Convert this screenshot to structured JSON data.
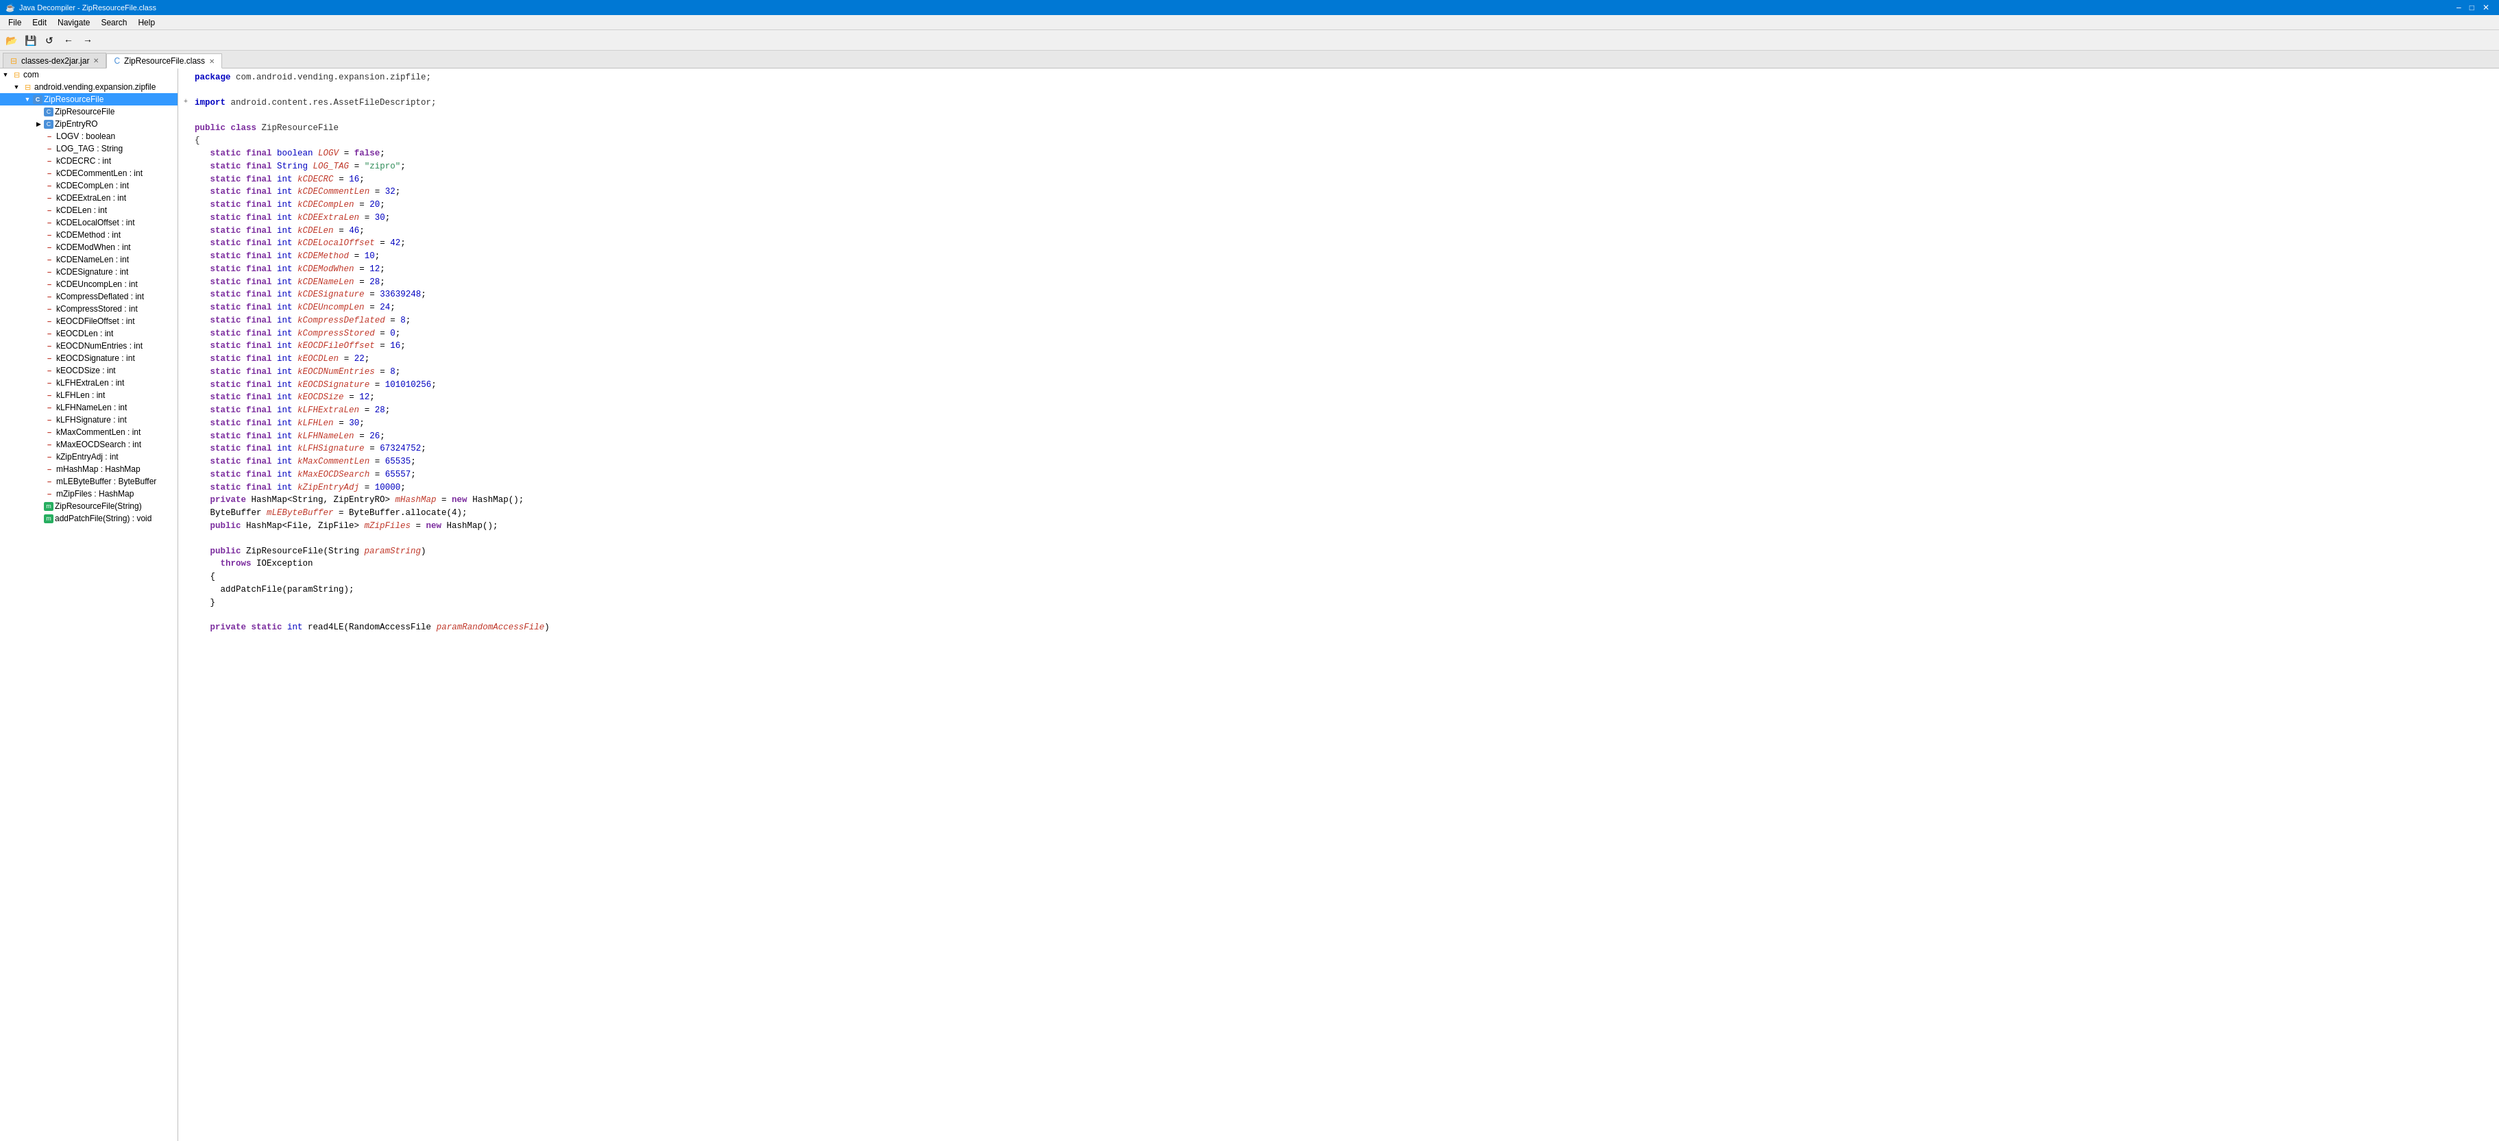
{
  "titleBar": {
    "title": "Java Decompiler - ZipResourceFile.class",
    "controls": [
      "–",
      "□",
      "✕"
    ]
  },
  "menuBar": {
    "items": [
      "File",
      "Edit",
      "Navigate",
      "Search",
      "Help"
    ]
  },
  "toolbar": {
    "buttons": [
      "📂",
      "💾",
      "↩",
      "←",
      "→"
    ]
  },
  "tabs": {
    "openTabs": [
      {
        "label": "classes-dex2jar.jar",
        "closeable": true,
        "active": false
      },
      {
        "label": "ZipResourceFile.class",
        "closeable": true,
        "active": true
      }
    ]
  },
  "tree": {
    "items": [
      {
        "indent": 0,
        "expand": "▼",
        "icon": "□",
        "iconClass": "icon-package",
        "label": "com",
        "type": "package"
      },
      {
        "indent": 1,
        "expand": "▼",
        "icon": "□",
        "iconClass": "icon-package",
        "label": "android.vending.expansion.zipfile",
        "type": "package"
      },
      {
        "indent": 2,
        "expand": "▼",
        "icon": "C",
        "iconClass": "icon-class",
        "label": "ZipResourceFile",
        "type": "class",
        "selected": true
      },
      {
        "indent": 3,
        "expand": " ",
        "icon": "C",
        "iconClass": "icon-class",
        "label": "ZipResourceFile",
        "type": "class"
      },
      {
        "indent": 3,
        "expand": "▶",
        "icon": "C",
        "iconClass": "icon-class",
        "label": "ZipEntryRO",
        "type": "class"
      },
      {
        "indent": 3,
        "expand": " ",
        "icon": "f",
        "iconClass": "icon-field",
        "label": "LOGV : boolean",
        "type": "field"
      },
      {
        "indent": 3,
        "expand": " ",
        "icon": "f",
        "iconClass": "icon-field",
        "label": "LOG_TAG : String",
        "type": "field"
      },
      {
        "indent": 3,
        "expand": " ",
        "icon": "f",
        "iconClass": "icon-field",
        "label": "kCDECRC : int",
        "type": "field"
      },
      {
        "indent": 3,
        "expand": " ",
        "icon": "f",
        "iconClass": "icon-field",
        "label": "kCDECommentLen : int",
        "type": "field"
      },
      {
        "indent": 3,
        "expand": " ",
        "icon": "f",
        "iconClass": "icon-field",
        "label": "kCDECompLen : int",
        "type": "field"
      },
      {
        "indent": 3,
        "expand": " ",
        "icon": "f",
        "iconClass": "icon-field",
        "label": "kCDEExtraLen : int",
        "type": "field"
      },
      {
        "indent": 3,
        "expand": " ",
        "icon": "f",
        "iconClass": "icon-field",
        "label": "kCDELen : int",
        "type": "field"
      },
      {
        "indent": 3,
        "expand": " ",
        "icon": "f",
        "iconClass": "icon-field",
        "label": "kCDELocalOffset : int",
        "type": "field"
      },
      {
        "indent": 3,
        "expand": " ",
        "icon": "f",
        "iconClass": "icon-field",
        "label": "kCDEMethod : int",
        "type": "field"
      },
      {
        "indent": 3,
        "expand": " ",
        "icon": "f",
        "iconClass": "icon-field",
        "label": "kCDEModWhen : int",
        "type": "field"
      },
      {
        "indent": 3,
        "expand": " ",
        "icon": "f",
        "iconClass": "icon-field",
        "label": "kCDENameLen : int",
        "type": "field"
      },
      {
        "indent": 3,
        "expand": " ",
        "icon": "f",
        "iconClass": "icon-field",
        "label": "kCDESignature : int",
        "type": "field"
      },
      {
        "indent": 3,
        "expand": " ",
        "icon": "f",
        "iconClass": "icon-field",
        "label": "kCDEUncompLen : int",
        "type": "field"
      },
      {
        "indent": 3,
        "expand": " ",
        "icon": "f",
        "iconClass": "icon-field",
        "label": "kCompressDeflated : int",
        "type": "field"
      },
      {
        "indent": 3,
        "expand": " ",
        "icon": "f",
        "iconClass": "icon-field",
        "label": "kCompressStored : int",
        "type": "field"
      },
      {
        "indent": 3,
        "expand": " ",
        "icon": "f",
        "iconClass": "icon-field",
        "label": "kEOCDFileOffset : int",
        "type": "field"
      },
      {
        "indent": 3,
        "expand": " ",
        "icon": "f",
        "iconClass": "icon-field",
        "label": "kEOCDLen : int",
        "type": "field"
      },
      {
        "indent": 3,
        "expand": " ",
        "icon": "f",
        "iconClass": "icon-field",
        "label": "kEOCDNumEntries : int",
        "type": "field"
      },
      {
        "indent": 3,
        "expand": " ",
        "icon": "f",
        "iconClass": "icon-field",
        "label": "kEOCDSignature : int",
        "type": "field"
      },
      {
        "indent": 3,
        "expand": " ",
        "icon": "f",
        "iconClass": "icon-field",
        "label": "kEOCDSize : int",
        "type": "field"
      },
      {
        "indent": 3,
        "expand": " ",
        "icon": "f",
        "iconClass": "icon-field",
        "label": "kLFHExtraLen : int",
        "type": "field"
      },
      {
        "indent": 3,
        "expand": " ",
        "icon": "f",
        "iconClass": "icon-field",
        "label": "kLFHLen : int",
        "type": "field"
      },
      {
        "indent": 3,
        "expand": " ",
        "icon": "f",
        "iconClass": "icon-field",
        "label": "kLFHNameLen : int",
        "type": "field"
      },
      {
        "indent": 3,
        "expand": " ",
        "icon": "f",
        "iconClass": "icon-field",
        "label": "kLFHSignature : int",
        "type": "field"
      },
      {
        "indent": 3,
        "expand": " ",
        "icon": "f",
        "iconClass": "icon-field",
        "label": "kMaxCommentLen : int",
        "type": "field"
      },
      {
        "indent": 3,
        "expand": " ",
        "icon": "f",
        "iconClass": "icon-field",
        "label": "kMaxEOCDSearch : int",
        "type": "field"
      },
      {
        "indent": 3,
        "expand": " ",
        "icon": "f",
        "iconClass": "icon-field",
        "label": "kZipEntryAdj : int",
        "type": "field"
      },
      {
        "indent": 3,
        "expand": " ",
        "icon": "f",
        "iconClass": "icon-field",
        "label": "mHashMap : HashMap<Str...",
        "type": "field"
      },
      {
        "indent": 3,
        "expand": " ",
        "icon": "f",
        "iconClass": "icon-field",
        "label": "mLEByteBuffer : ByteBuffer",
        "type": "field"
      },
      {
        "indent": 3,
        "expand": " ",
        "icon": "f",
        "iconClass": "icon-field",
        "label": "mZipFiles : HashMap<File, Z...",
        "type": "field"
      },
      {
        "indent": 3,
        "expand": " ",
        "icon": "m",
        "iconClass": "icon-method",
        "label": "ZipResourceFile(String)",
        "type": "method"
      },
      {
        "indent": 3,
        "expand": " ",
        "icon": "m",
        "iconClass": "icon-method",
        "label": "addPatchFile(String) : void",
        "type": "method"
      }
    ]
  },
  "code": {
    "lines": [
      {
        "expand": " ",
        "html": "<span class='kw2'>package</span> <span class='normal'>com.android.vending.expansion.zipfile;</span>"
      },
      {
        "expand": " ",
        "html": ""
      },
      {
        "expand": "+",
        "html": "<span class='kw2'>import</span> <span class='normal'>android.content.res.AssetFileDescriptor;</span>"
      },
      {
        "expand": " ",
        "html": ""
      },
      {
        "expand": " ",
        "html": "<span class='kw'>public</span> <span class='kw'>class</span> <span class='normal'>ZipResourceFile</span>"
      },
      {
        "expand": " ",
        "html": "<span class='normal'>{</span>"
      },
      {
        "expand": " ",
        "html": "   <span class='kw'>static</span> <span class='kw'>final</span> <span class='type'>boolean</span> <span class='field'>LOGV</span> = <span class='kw'>false</span>;"
      },
      {
        "expand": " ",
        "html": "   <span class='kw'>static</span> <span class='kw'>final</span> <span class='type'>String</span> <span class='field'>LOG_TAG</span> = <span class='str'>\"zipro\"</span>;"
      },
      {
        "expand": " ",
        "html": "   <span class='kw'>static</span> <span class='kw'>final</span> <span class='type'>int</span> <span class='field'>kCDECRC</span> = <span class='num'>16</span>;"
      },
      {
        "expand": " ",
        "html": "   <span class='kw'>static</span> <span class='kw'>final</span> <span class='type'>int</span> <span class='field'>kCDECommentLen</span> = <span class='num'>32</span>;"
      },
      {
        "expand": " ",
        "html": "   <span class='kw'>static</span> <span class='kw'>final</span> <span class='type'>int</span> <span class='field'>kCDECompLen</span> = <span class='num'>20</span>;"
      },
      {
        "expand": " ",
        "html": "   <span class='kw'>static</span> <span class='kw'>final</span> <span class='type'>int</span> <span class='field'>kCDEExtraLen</span> = <span class='num'>30</span>;"
      },
      {
        "expand": " ",
        "html": "   <span class='kw'>static</span> <span class='kw'>final</span> <span class='type'>int</span> <span class='field'>kCDELen</span> = <span class='num'>46</span>;"
      },
      {
        "expand": " ",
        "html": "   <span class='kw'>static</span> <span class='kw'>final</span> <span class='type'>int</span> <span class='field'>kCDELocalOffset</span> = <span class='num'>42</span>;"
      },
      {
        "expand": " ",
        "html": "   <span class='kw'>static</span> <span class='kw'>final</span> <span class='type'>int</span> <span class='field'>kCDEMethod</span> = <span class='num'>10</span>;"
      },
      {
        "expand": " ",
        "html": "   <span class='kw'>static</span> <span class='kw'>final</span> <span class='type'>int</span> <span class='field'>kCDEModWhen</span> = <span class='num'>12</span>;"
      },
      {
        "expand": " ",
        "html": "   <span class='kw'>static</span> <span class='kw'>final</span> <span class='type'>int</span> <span class='field'>kCDENameLen</span> = <span class='num'>28</span>;"
      },
      {
        "expand": " ",
        "html": "   <span class='kw'>static</span> <span class='kw'>final</span> <span class='type'>int</span> <span class='field'>kCDESignature</span> = <span class='num'>33639248</span>;"
      },
      {
        "expand": " ",
        "html": "   <span class='kw'>static</span> <span class='kw'>final</span> <span class='type'>int</span> <span class='field'>kCDEUncompLen</span> = <span class='num'>24</span>;"
      },
      {
        "expand": " ",
        "html": "   <span class='kw'>static</span> <span class='kw'>final</span> <span class='type'>int</span> <span class='field'>kCompressDeflated</span> = <span class='num'>8</span>;"
      },
      {
        "expand": " ",
        "html": "   <span class='kw'>static</span> <span class='kw'>final</span> <span class='type'>int</span> <span class='field'>kCompressStored</span> = <span class='num'>0</span>;"
      },
      {
        "expand": " ",
        "html": "   <span class='kw'>static</span> <span class='kw'>final</span> <span class='type'>int</span> <span class='field'>kEOCDFileOffset</span> = <span class='num'>16</span>;"
      },
      {
        "expand": " ",
        "html": "   <span class='kw'>static</span> <span class='kw'>final</span> <span class='type'>int</span> <span class='field'>kEOCDLen</span> = <span class='num'>22</span>;"
      },
      {
        "expand": " ",
        "html": "   <span class='kw'>static</span> <span class='kw'>final</span> <span class='type'>int</span> <span class='field'>kEOCDNumEntries</span> = <span class='num'>8</span>;"
      },
      {
        "expand": " ",
        "html": "   <span class='kw'>static</span> <span class='kw'>final</span> <span class='type'>int</span> <span class='field'>kEOCDSignature</span> = <span class='num'>101010256</span>;"
      },
      {
        "expand": " ",
        "html": "   <span class='kw'>static</span> <span class='kw'>final</span> <span class='type'>int</span> <span class='field'>kEOCDSize</span> = <span class='num'>12</span>;"
      },
      {
        "expand": " ",
        "html": "   <span class='kw'>static</span> <span class='kw'>final</span> <span class='type'>int</span> <span class='field'>kLFHExtraLen</span> = <span class='num'>28</span>;"
      },
      {
        "expand": " ",
        "html": "   <span class='kw'>static</span> <span class='kw'>final</span> <span class='type'>int</span> <span class='field'>kLFHLen</span> = <span class='num'>30</span>;"
      },
      {
        "expand": " ",
        "html": "   <span class='kw'>static</span> <span class='kw'>final</span> <span class='type'>int</span> <span class='field'>kLFHNameLen</span> = <span class='num'>26</span>;"
      },
      {
        "expand": " ",
        "html": "   <span class='kw'>static</span> <span class='kw'>final</span> <span class='type'>int</span> <span class='field'>kLFHSignature</span> = <span class='num'>67324752</span>;"
      },
      {
        "expand": " ",
        "html": "   <span class='kw'>static</span> <span class='kw'>final</span> <span class='type'>int</span> <span class='field'>kMaxCommentLen</span> = <span class='num'>65535</span>;"
      },
      {
        "expand": " ",
        "html": "   <span class='kw'>static</span> <span class='kw'>final</span> <span class='type'>int</span> <span class='field'>kMaxEOCDSearch</span> = <span class='num'>65557</span>;"
      },
      {
        "expand": " ",
        "html": "   <span class='kw'>static</span> <span class='kw'>final</span> <span class='type'>int</span> <span class='field'>kZipEntryAdj</span> = <span class='num'>10000</span>;"
      },
      {
        "expand": " ",
        "html": "   <span class='kw'>private</span> HashMap&lt;String, ZipEntryRO&gt; <span class='field'>mHashMap</span> = <span class='kw'>new</span> HashMap();"
      },
      {
        "expand": " ",
        "html": "   ByteBuffer <span class='field'>mLEByteBuffer</span> = ByteBuffer.allocate(4);"
      },
      {
        "expand": " ",
        "html": "   <span class='kw'>public</span> HashMap&lt;File, ZipFile&gt; <span class='field'>mZipFiles</span> = <span class='kw'>new</span> HashMap();"
      },
      {
        "expand": " ",
        "html": ""
      },
      {
        "expand": " ",
        "html": "   <span class='kw'>public</span> ZipResourceFile(String <span class='field'>paramString</span>)"
      },
      {
        "expand": " ",
        "html": "     <span class='kw'>throws</span> IOException"
      },
      {
        "expand": " ",
        "html": "   {"
      },
      {
        "expand": " ",
        "html": "     addPatchFile(paramString);"
      },
      {
        "expand": " ",
        "html": "   }"
      },
      {
        "expand": " ",
        "html": ""
      },
      {
        "expand": " ",
        "html": "   <span class='kw'>private</span> <span class='kw'>static</span> <span class='type'>int</span> read4LE(RandomAccessFile <span class='field'>paramRandomAccessFile</span>)"
      }
    ]
  }
}
